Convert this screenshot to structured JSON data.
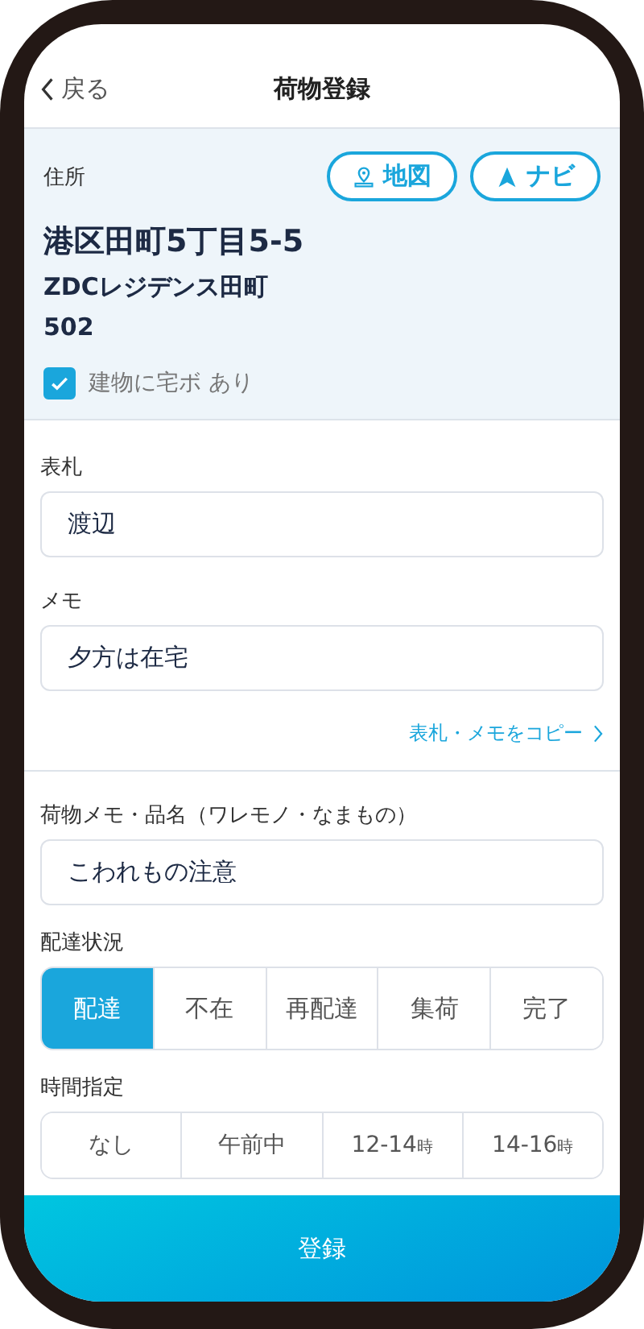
{
  "header": {
    "back": "戻る",
    "title": "荷物登録"
  },
  "address": {
    "label": "住所",
    "map_button": "地図",
    "navi_button": "ナビ",
    "line1": "港区田町5丁目5-5",
    "line2": "ZDCレジデンス田町",
    "line3": "502",
    "checkbox": {
      "label": "建物に宅ボ あり",
      "checked": true
    }
  },
  "nameplate": {
    "label": "表札",
    "value": "渡辺"
  },
  "memo": {
    "label": "メモ",
    "value": "夕方は在宅"
  },
  "copy_link": "表札・メモをコピー",
  "item_memo": {
    "label": "荷物メモ・品名（ワレモノ・なまもの）",
    "value": "こわれもの注意"
  },
  "status": {
    "label": "配達状況",
    "options": [
      {
        "label": "配達",
        "selected": true
      },
      {
        "label": "不在",
        "selected": false
      },
      {
        "label": "再配達",
        "selected": false
      },
      {
        "label": "集荷",
        "selected": false
      },
      {
        "label": "完了",
        "selected": false
      }
    ]
  },
  "time": {
    "label": "時間指定",
    "options": [
      {
        "label": "なし",
        "selected": false
      },
      {
        "label": "午前中",
        "selected": false
      },
      {
        "label": "12-14",
        "unit": "時",
        "selected": false
      },
      {
        "label": "14-16",
        "unit": "時",
        "selected": false
      }
    ]
  },
  "submit": "登録"
}
